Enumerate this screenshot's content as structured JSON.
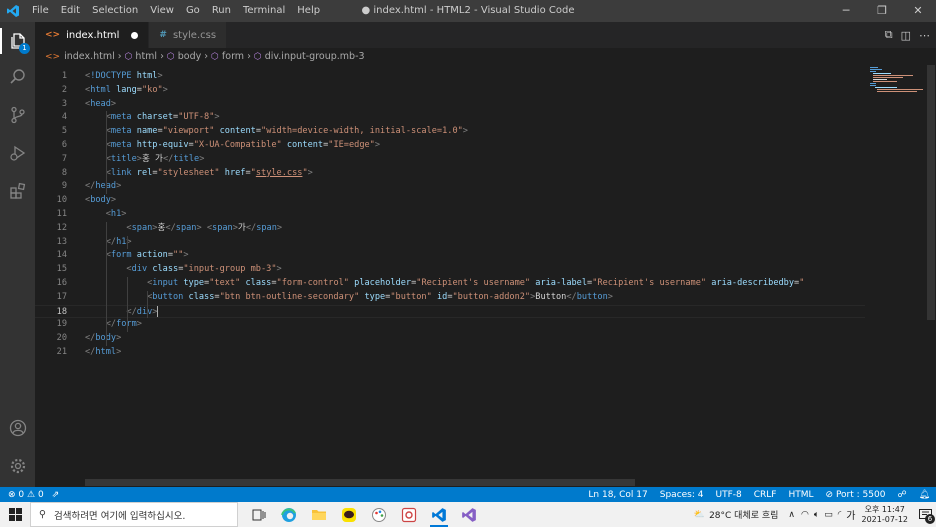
{
  "window": {
    "title": "● index.html - HTML2 - Visual Studio Code",
    "menu": [
      "File",
      "Edit",
      "Selection",
      "View",
      "Go",
      "Run",
      "Terminal",
      "Help"
    ],
    "controls": {
      "minimize": "─",
      "maximize": "❐",
      "close": "✕"
    }
  },
  "activity_bar": {
    "items": [
      "explorer-icon",
      "search-icon",
      "source-control-icon",
      "run-debug-icon",
      "extensions-icon"
    ],
    "explorer_badge": "1",
    "bottom": [
      "accounts-icon",
      "manage-icon"
    ]
  },
  "tabs": [
    {
      "label": "index.html",
      "icon": "<>",
      "modified": true,
      "active": true
    },
    {
      "label": "style.css",
      "icon": "#",
      "modified": false,
      "active": false
    }
  ],
  "breadcrumb": [
    "index.html",
    "html",
    "body",
    "form",
    "div.input-group.mb-3"
  ],
  "editor": {
    "current_line": 18,
    "lines": [
      [
        [
          "br",
          "<"
        ],
        [
          "tg",
          "!DOCTYPE"
        ],
        [
          "tx",
          " "
        ],
        [
          "at",
          "html"
        ],
        [
          "br",
          ">"
        ]
      ],
      [
        [
          "br",
          "<"
        ],
        [
          "tg",
          "html"
        ],
        [
          "tx",
          " "
        ],
        [
          "at",
          "lang"
        ],
        [
          "tx",
          "="
        ],
        [
          "st",
          "\"ko\""
        ],
        [
          "br",
          ">"
        ]
      ],
      [
        [
          "br",
          "<"
        ],
        [
          "tg",
          "head"
        ],
        [
          "br",
          ">"
        ]
      ],
      [
        [
          "tx",
          "    "
        ],
        [
          "br",
          "<"
        ],
        [
          "tg",
          "meta"
        ],
        [
          "tx",
          " "
        ],
        [
          "at",
          "charset"
        ],
        [
          "tx",
          "="
        ],
        [
          "st",
          "\"UTF-8\""
        ],
        [
          "br",
          ">"
        ]
      ],
      [
        [
          "tx",
          "    "
        ],
        [
          "br",
          "<"
        ],
        [
          "tg",
          "meta"
        ],
        [
          "tx",
          " "
        ],
        [
          "at",
          "name"
        ],
        [
          "tx",
          "="
        ],
        [
          "st",
          "\"viewport\""
        ],
        [
          "tx",
          " "
        ],
        [
          "at",
          "content"
        ],
        [
          "tx",
          "="
        ],
        [
          "st",
          "\"width=device-width, initial-scale=1.0\""
        ],
        [
          "br",
          ">"
        ]
      ],
      [
        [
          "tx",
          "    "
        ],
        [
          "br",
          "<"
        ],
        [
          "tg",
          "meta"
        ],
        [
          "tx",
          " "
        ],
        [
          "at",
          "http-equiv"
        ],
        [
          "tx",
          "="
        ],
        [
          "st",
          "\"X-UA-Compatible\""
        ],
        [
          "tx",
          " "
        ],
        [
          "at",
          "content"
        ],
        [
          "tx",
          "="
        ],
        [
          "st",
          "\"IE=edge\""
        ],
        [
          "br",
          ">"
        ]
      ],
      [
        [
          "tx",
          "    "
        ],
        [
          "br",
          "<"
        ],
        [
          "tg",
          "title"
        ],
        [
          "br",
          ">"
        ],
        [
          "tx",
          "홍 가"
        ],
        [
          "br",
          "</"
        ],
        [
          "tg",
          "title"
        ],
        [
          "br",
          ">"
        ]
      ],
      [
        [
          "tx",
          "    "
        ],
        [
          "br",
          "<"
        ],
        [
          "tg",
          "link"
        ],
        [
          "tx",
          " "
        ],
        [
          "at",
          "rel"
        ],
        [
          "tx",
          "="
        ],
        [
          "st",
          "\"stylesheet\""
        ],
        [
          "tx",
          " "
        ],
        [
          "at",
          "href"
        ],
        [
          "tx",
          "="
        ],
        [
          "st",
          "\""
        ],
        [
          "st u",
          "style.css"
        ],
        [
          "st",
          "\""
        ],
        [
          "br",
          ">"
        ]
      ],
      [
        [
          "br",
          "</"
        ],
        [
          "tg",
          "head"
        ],
        [
          "br",
          ">"
        ]
      ],
      [
        [
          "br",
          "<"
        ],
        [
          "tg",
          "body"
        ],
        [
          "br",
          ">"
        ]
      ],
      [
        [
          "tx",
          "    "
        ],
        [
          "br",
          "<"
        ],
        [
          "tg",
          "h1"
        ],
        [
          "br",
          ">"
        ]
      ],
      [
        [
          "tx",
          "        "
        ],
        [
          "br",
          "<"
        ],
        [
          "tg",
          "span"
        ],
        [
          "br",
          ">"
        ],
        [
          "tx",
          "홍"
        ],
        [
          "br",
          "</"
        ],
        [
          "tg",
          "span"
        ],
        [
          "br",
          ">"
        ],
        [
          "tx",
          " "
        ],
        [
          "br",
          "<"
        ],
        [
          "tg",
          "span"
        ],
        [
          "br",
          ">"
        ],
        [
          "tx",
          "가"
        ],
        [
          "br",
          "</"
        ],
        [
          "tg",
          "span"
        ],
        [
          "br",
          ">"
        ]
      ],
      [
        [
          "tx",
          "    "
        ],
        [
          "br",
          "</"
        ],
        [
          "tg",
          "h1"
        ],
        [
          "br",
          ">"
        ]
      ],
      [
        [
          "tx",
          "    "
        ],
        [
          "br",
          "<"
        ],
        [
          "tg",
          "form"
        ],
        [
          "tx",
          " "
        ],
        [
          "at",
          "action"
        ],
        [
          "tx",
          "="
        ],
        [
          "st",
          "\"\""
        ],
        [
          "br",
          ">"
        ]
      ],
      [
        [
          "tx",
          "        "
        ],
        [
          "br",
          "<"
        ],
        [
          "tg",
          "div"
        ],
        [
          "tx",
          " "
        ],
        [
          "at",
          "class"
        ],
        [
          "tx",
          "="
        ],
        [
          "st",
          "\"input-group mb-3\""
        ],
        [
          "br",
          ">"
        ]
      ],
      [
        [
          "tx",
          "            "
        ],
        [
          "br",
          "<"
        ],
        [
          "tg",
          "input"
        ],
        [
          "tx",
          " "
        ],
        [
          "at",
          "type"
        ],
        [
          "tx",
          "="
        ],
        [
          "st",
          "\"text\""
        ],
        [
          "tx",
          " "
        ],
        [
          "at",
          "class"
        ],
        [
          "tx",
          "="
        ],
        [
          "st",
          "\"form-control\""
        ],
        [
          "tx",
          " "
        ],
        [
          "at",
          "placeholder"
        ],
        [
          "tx",
          "="
        ],
        [
          "st",
          "\"Recipient's username\""
        ],
        [
          "tx",
          " "
        ],
        [
          "at",
          "aria-label"
        ],
        [
          "tx",
          "="
        ],
        [
          "st",
          "\"Recipient's username\""
        ],
        [
          "tx",
          " "
        ],
        [
          "at",
          "aria-describedby"
        ],
        [
          "tx",
          "="
        ],
        [
          "st",
          "\""
        ]
      ],
      [
        [
          "tx",
          "            "
        ],
        [
          "br",
          "<"
        ],
        [
          "tg",
          "button"
        ],
        [
          "tx",
          " "
        ],
        [
          "at",
          "class"
        ],
        [
          "tx",
          "="
        ],
        [
          "st",
          "\"btn btn-outline-secondary\""
        ],
        [
          "tx",
          " "
        ],
        [
          "at",
          "type"
        ],
        [
          "tx",
          "="
        ],
        [
          "st",
          "\"button\""
        ],
        [
          "tx",
          " "
        ],
        [
          "at",
          "id"
        ],
        [
          "tx",
          "="
        ],
        [
          "st",
          "\"button-addon2\""
        ],
        [
          "br",
          ">"
        ],
        [
          "tx",
          "Button"
        ],
        [
          "br",
          "</"
        ],
        [
          "tg",
          "button"
        ],
        [
          "br",
          ">"
        ]
      ],
      [
        [
          "tx",
          "        "
        ],
        [
          "br",
          "</"
        ],
        [
          "tg",
          "div"
        ],
        [
          "br",
          ">"
        ]
      ],
      [
        [
          "tx",
          "    "
        ],
        [
          "br",
          "</"
        ],
        [
          "tg",
          "form"
        ],
        [
          "br",
          ">"
        ]
      ],
      [
        [
          "br",
          "</"
        ],
        [
          "tg",
          "body"
        ],
        [
          "br",
          ">"
        ]
      ],
      [
        [
          "br",
          "</"
        ],
        [
          "tg",
          "html"
        ],
        [
          "br",
          ">"
        ]
      ]
    ]
  },
  "status_bar": {
    "errors": "0",
    "warnings": "0",
    "position": "Ln 18, Col 17",
    "spaces": "Spaces: 4",
    "encoding": "UTF-8",
    "eol": "CRLF",
    "language": "HTML",
    "port": "Port : 5500"
  },
  "taskbar": {
    "search_placeholder": "검색하려면 여기에 입력하십시오.",
    "weather": "28°C  대체로 흐림",
    "ime": "가",
    "time": "오후 11:47",
    "date": "2021-07-12",
    "notification_count": "6"
  },
  "colors": {
    "accent": "#007acc",
    "title_bar": "#3c3c3c",
    "activity_bar": "#333333",
    "editor_bg": "#1e1e1e"
  }
}
